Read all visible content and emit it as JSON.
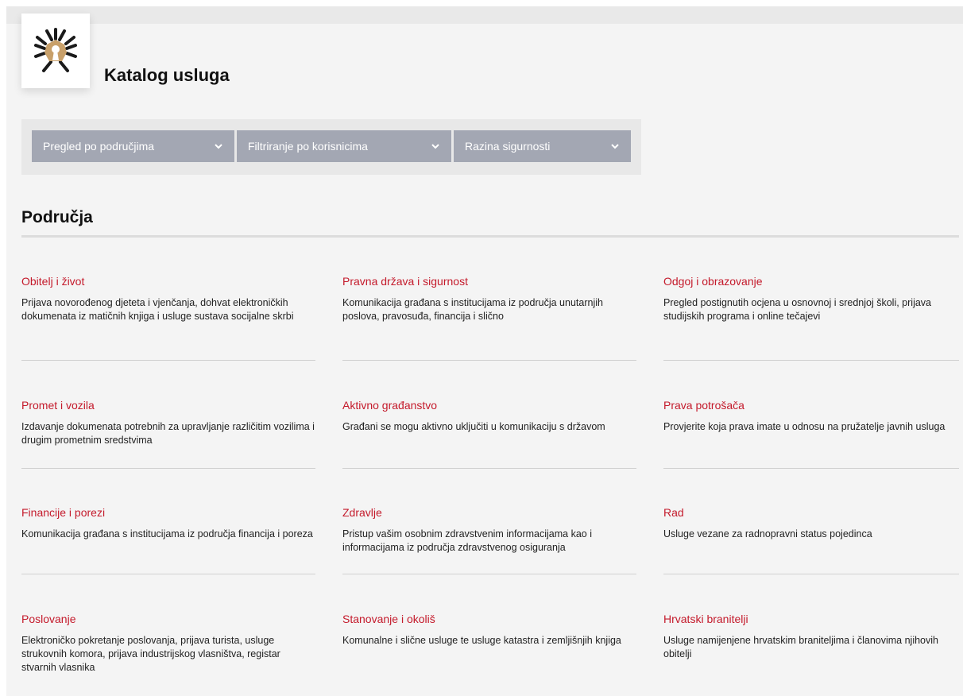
{
  "header": {
    "title": "Katalog usluga"
  },
  "filters": [
    {
      "label": "Pregled po područjima",
      "icon": "chevron-down-icon"
    },
    {
      "label": "Filtriranje po korisnicima",
      "icon": "chevron-down-icon"
    },
    {
      "label": "Razina sigurnosti",
      "icon": "chevron-down-icon"
    }
  ],
  "section": {
    "title": "Područja"
  },
  "areas": [
    {
      "title": "Obitelj i život",
      "desc": "Prijava novorođenog djeteta i vjenčanja, dohvat elektroničkih dokumenata iz matičnih knjiga i usluge sustava socijalne skrbi"
    },
    {
      "title": "Pravna država i sigurnost",
      "desc": "Komunikacija građana s institucijama iz područja unutarnjih poslova, pravosuđa, financija i slično"
    },
    {
      "title": "Odgoj i obrazovanje",
      "desc": "Pregled postignutih ocjena u osnovnoj i srednjoj školi, prijava studijskih programa i online tečajevi"
    },
    {
      "title": "Promet i vozila",
      "desc": "Izdavanje dokumenata potrebnih za upravljanje različitim vozilima i drugim prometnim sredstvima"
    },
    {
      "title": "Aktivno građanstvo",
      "desc": "Građani se mogu aktivno uključiti u komunikaciju s državom"
    },
    {
      "title": "Prava potrošača",
      "desc": "Provjerite koja prava imate u odnosu na pružatelje javnih usluga"
    },
    {
      "title": "Financije i porezi",
      "desc": "Komunikacija građana s institucijama iz područja financija i poreza"
    },
    {
      "title": "Zdravlje",
      "desc": "Pristup vašim osobnim zdravstvenim informacijama kao i informacijama iz područja zdravstvenog osiguranja"
    },
    {
      "title": "Rad",
      "desc": "Usluge vezane za radnopravni status pojedinca"
    },
    {
      "title": "Poslovanje",
      "desc": "Elektroničko pokretanje poslovanja, prijava turista, usluge strukovnih komora, prijava industrijskog vlasništva, registar stvarnih vlasnika"
    },
    {
      "title": "Stanovanje i okoliš",
      "desc": "Komunalne i slične usluge te usluge katastra i zemljišnjih knjiga"
    },
    {
      "title": "Hrvatski branitelji",
      "desc": "Usluge namijenjene hrvatskim braniteljima i članovima njihovih obitelji"
    }
  ],
  "colors": {
    "accent": "#c41a2b",
    "filter_bg": "#a3a7b3",
    "page_bg": "#f4f4f4"
  },
  "logo": {
    "icon": "government-emblem-logo"
  }
}
